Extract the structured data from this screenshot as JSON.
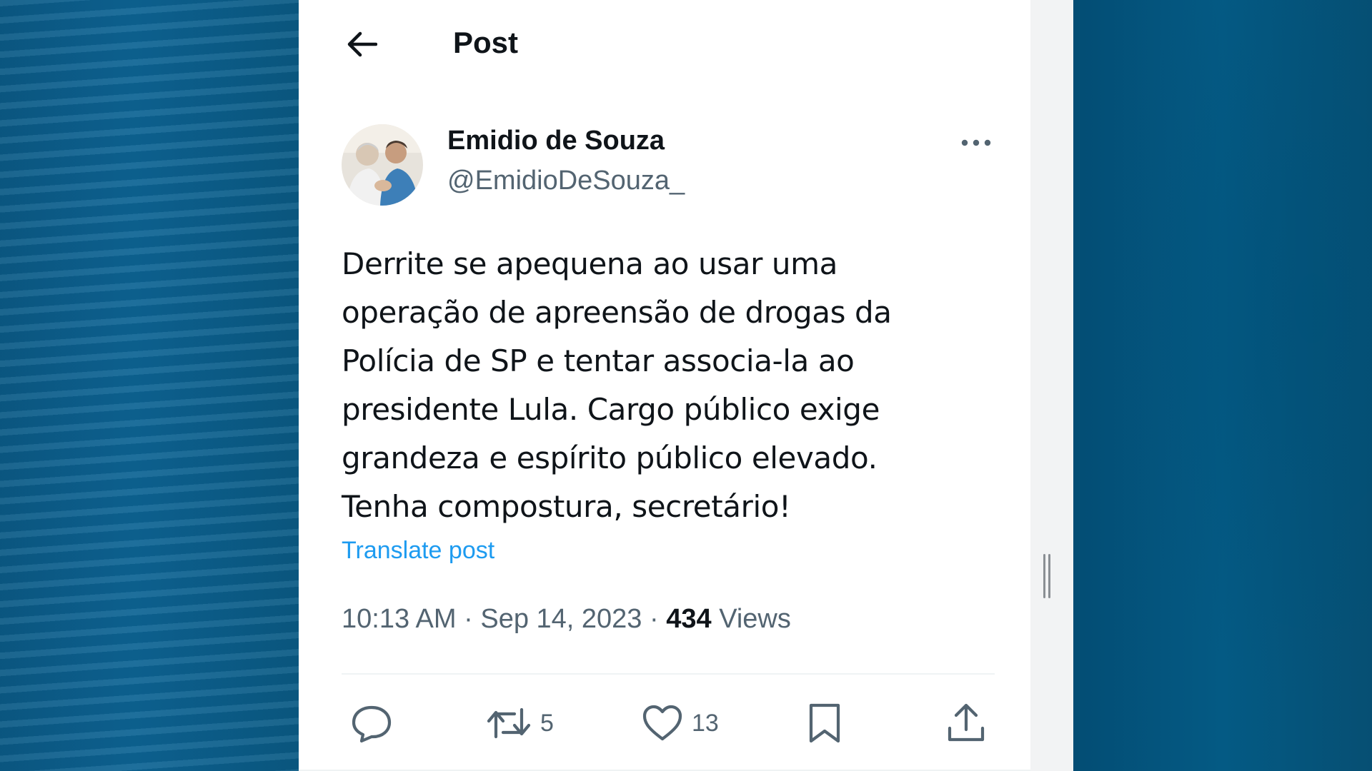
{
  "header": {
    "title": "Post",
    "back_icon": "arrow-left-icon"
  },
  "post": {
    "author_name": "Emidio de Souza",
    "author_handle": "@EmidioDeSouza_",
    "text_lines": [
      "Derrite se apequena ao usar uma",
      "operação de apreensão de drogas da",
      "Polícia de SP e tentar associa-la ao",
      "presidente Lula. Cargo público exige",
      "grandeza e espírito público elevado.",
      "Tenha compostura, secretário!"
    ],
    "translate_label": "Translate post",
    "time": "10:13 AM",
    "date": "Sep 14, 2023",
    "views_count": "434",
    "views_label": "Views",
    "separator": "·"
  },
  "actions": {
    "reply_count": "",
    "repost_count": "5",
    "like_count": "13"
  },
  "colors": {
    "accent": "#1d9bf0",
    "text_primary": "#0f1419",
    "text_secondary": "#536471"
  }
}
